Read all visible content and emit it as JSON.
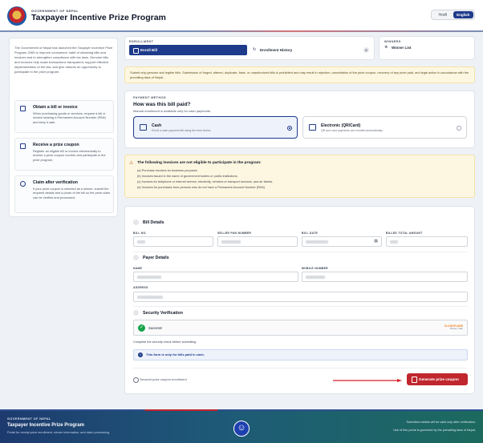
{
  "header": {
    "gov_label": "GOVERNMENT OF NEPAL",
    "title": "Taxpayer Incentive Prize Program",
    "lang_nepali": "नेपाली",
    "lang_english": "English"
  },
  "left_panel": {
    "intro": "The Government of Nepal has launched the Taxpayer Incentive Prize Program 2083 to improve consumers' habit of obtaining bills and invoices and to strengthen compliance with tax laws. Genuine bills and invoices help make transactions transparent, support effective implementation of the law, and give citizens an opportunity to participate in the prize program.",
    "steps": [
      {
        "title": "Obtain a bill or invoice",
        "desc": "When purchasing goods or services, request a bill or invoice bearing a Permanent Account Number (PAN) and keep it safe.",
        "icon": "document-icon"
      },
      {
        "title": "Receive a prize coupon",
        "desc": "Register an eligible bill or invoice electronically to receive a prize coupon number and participate in the prize program.",
        "icon": "ticket-icon"
      },
      {
        "title": "Claim after verification",
        "desc": "If your prize coupon is selected as a winner, submit the required details and a photo of the bill so the prize claim can be verified and processed.",
        "icon": "clock-icon"
      }
    ]
  },
  "enrollment": {
    "label": "ENROLLMENT",
    "enroll_bill": "Enroll Bill",
    "history": "Enrollment History",
    "history_count": "0"
  },
  "winners": {
    "label": "WINNERS",
    "link": "Winner List"
  },
  "notice": "Submit only genuine and legible bills. Submission of forged, altered, duplicate, false, or unauthorized bills is prohibited and may result in rejection, cancellation of the prize coupon, recovery of any prize paid, and legal action in accordance with the prevailing laws of Nepal.",
  "payment": {
    "label": "PAYMENT METHOD",
    "title": "How was this bill paid?",
    "subtitle": "Manual enrollment is available only for cash payments.",
    "options": [
      {
        "title": "Cash",
        "desc": "Enroll a cash payment bill using the form below.",
        "selected": true
      },
      {
        "title": "Electronic (QR/Card)",
        "desc": "QR and card payments are enrolled automatically.",
        "selected": false
      }
    ]
  },
  "ineligible": {
    "title": "The following invoices are not eligible to participate in the program:",
    "items": [
      "(a)  Purchase invoices for business purposes.",
      "(b)  Invoices issued in the name of government bodies or public institutions.",
      "(c)  Invoices for telephone or internet service, electricity, vehicles or transport services, and air tickets.",
      "(d)  Invoices for purchases from persons who do not have a Permanent Account Number (PAN)."
    ]
  },
  "form": {
    "bill_details": "Bill Details",
    "bill_no": "BILL NO.",
    "seller_pan": "SELLER PAN NUMBER",
    "bill_date": "BILL DATE",
    "billed_total": "BILLED TOTAL AMOUNT",
    "payer_details": "Payer Details",
    "name": "NAME",
    "mobile": "MOBILE NUMBER",
    "address": "ADDRESS",
    "security": "Security Verification",
    "success": "Success!",
    "cloudflare": "CLOUDFLARE",
    "cloudflare_sub": "Privacy  •  Help",
    "captcha_note": "Complete the security check before submitting.",
    "cash_only": "This form is only for bills paid in cash.",
    "secured": "Secured prize coupon enrollment",
    "generate": "Generate prize coupon"
  },
  "footer": {
    "gov_label": "GOVERNMENT OF NEPAL",
    "title": "Taxpayer Incentive Prize Program",
    "subtitle": "Portal for receipt prize enrollment, winner information, and claim processing.",
    "right1": "Submitted details will be valid only after verification.",
    "right2": "Use of this portal is governed by the prevailing laws of Nepal."
  },
  "colors": {
    "primary": "#1e3a8a",
    "danger": "#c0262d",
    "success": "#16a34a",
    "notice_bg": "#fdf7e2"
  }
}
